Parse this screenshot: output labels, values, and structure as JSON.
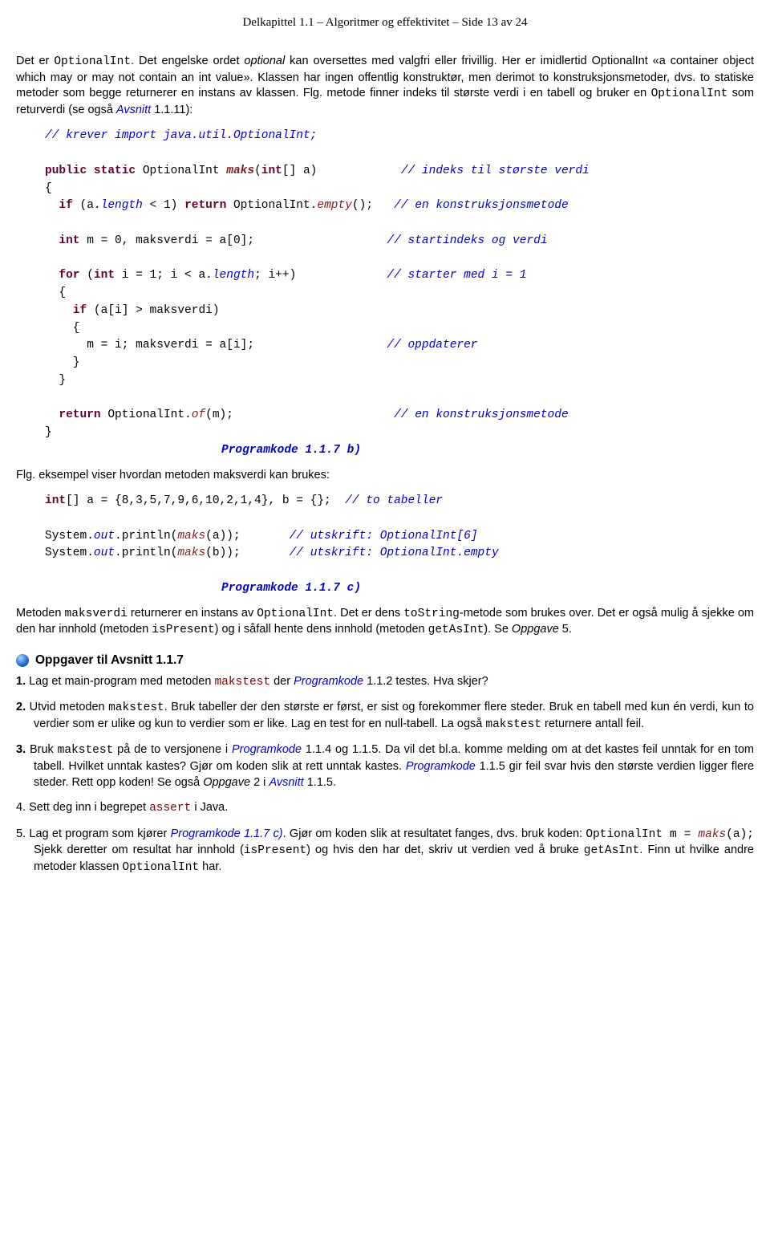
{
  "header": "Delkapittel 1.1 – Algoritmer og effektivitet – Side 13 av 24",
  "para1": {
    "t1": "Det er ",
    "optionalint": "OptionalInt",
    "t2": ". Det engelske ordet ",
    "optional": "optional",
    "t3": " kan oversettes med valgfri eller frivillig. Her er imidlertid OptionalInt «a container object which may or may not contain an int value». Klassen har ingen offentlig konstruktør, men derimot to konstruksjonsmetoder, dvs. to statiske metoder som begge returnerer en instans av klassen. Flg. metode finner indeks til største verdi i en tabell og bruker en ",
    "optionalint2": "OptionalInt",
    "t4": " som returverdi (se også ",
    "link1": "Avsnitt",
    "t5": " 1.1.11):"
  },
  "code1": {
    "l1c": "// krever import java.util.OptionalInt;",
    "l2a": "public static",
    "l2b": "OptionalInt",
    "l2c": "maks",
    "l2d": "(",
    "l2e": "int",
    "l2f": "[] a)",
    "l2cmt": "// indeks til største verdi",
    "l3": "{",
    "l4a": "  if",
    "l4b": " (a.",
    "l4c": "length",
    "l4d": " < 1) ",
    "l4e": "return",
    "l4f": " OptionalInt.",
    "l4g": "empty",
    "l4h": "();",
    "l4cmt": "// en konstruksjonsmetode",
    "l6a": "  int",
    "l6b": " m = 0, maksverdi = a[0];",
    "l6cmt": "// startindeks og verdi",
    "l8a": "  for",
    "l8b": " (",
    "l8c": "int",
    "l8d": " i = 1; i < a.",
    "l8e": "length",
    "l8f": "; i++)",
    "l8cmt": "// starter med i = 1",
    "l9": "  {",
    "l10a": "    if",
    "l10b": " (a[i] > maksverdi)",
    "l11": "    {",
    "l12a": "      m = i; maksverdi = a[i];",
    "l12cmt": "// oppdaterer",
    "l13": "    }",
    "l14": "  }",
    "l16a": "  return",
    "l16b": " OptionalInt.",
    "l16c": "of",
    "l16d": "(m);",
    "l16cmt": "// en konstruksjonsmetode",
    "l17": "}",
    "cap": "Programkode 1.1.7 b)"
  },
  "para2": "Flg. eksempel viser hvordan metoden maksverdi kan brukes:",
  "code2": {
    "l1a": "int",
    "l1b": "[] a = {8,3,5,7,9,6,10,2,1,4}, b = {};",
    "l1cmt": "// to tabeller",
    "l3a": "System.",
    "l3b": "out",
    "l3c": ".println(",
    "l3d": "maks",
    "l3e": "(a));",
    "l3cmt": "// utskrift: OptionalInt[6]",
    "l4a": "System.",
    "l4b": "out",
    "l4c": ".println(",
    "l4d": "maks",
    "l4e": "(b));",
    "l4cmt": "// utskrift: OptionalInt.empty",
    "cap": "Programkode 1.1.7 c)"
  },
  "para3": {
    "t1": "Metoden ",
    "m1": "maksverdi",
    "t2": " returnerer en instans av ",
    "m2": "OptionalInt",
    "t3": ". Det er dens ",
    "m3": "toString",
    "t4": "-metode som brukes over. Det er også mulig å sjekke om den har innhold (metoden ",
    "m4": "isPresent",
    "t5": ") og i såfall hente dens innhold (metoden ",
    "m5": "getAsInt",
    "t6": "). Se ",
    "m6": "Oppgave",
    "t7": " 5."
  },
  "section_title": "Oppgaver til Avsnitt 1.1.7",
  "ex1": {
    "n": "1.",
    "t1": " Lag et main-program med metoden ",
    "c1": "makstest",
    "t2": " der ",
    "c2": "Programkode",
    "t3": " 1.1.2 testes. Hva skjer?"
  },
  "ex2": {
    "n": "2.",
    "t1": " Utvid metoden ",
    "c1": "makstest",
    "t2": ". Bruk tabeller der den største er først, er sist og forekommer flere steder. Bruk en tabell med kun én verdi, kun to verdier som er ulike og kun to verdier som er like. Lag en test for en null-tabell. La også ",
    "c2": "makstest",
    "t3": " returnere antall feil."
  },
  "ex3": {
    "n": "3.",
    "t1": " Bruk ",
    "c1": "makstest",
    "t2": " på de to versjonene i ",
    "c2": "Programkode",
    "t3": " 1.1.4 og 1.1.5. Da vil det bl.a. komme melding om at det kastes feil unntak for en tom tabell. Hvilket unntak kastes? Gjør om koden slik at rett unntak kastes. ",
    "c3": "Programkode",
    "t4": " 1.1.5 gir feil svar hvis den største verdien ligger flere steder. Rett opp koden! Se også ",
    "c4": "Oppgave",
    "t5": " 2 i ",
    "c5": "Avsnitt",
    "t6": " 1.1.5."
  },
  "ex4": {
    "n": "4.",
    "t1": " Sett deg inn i begrepet ",
    "c1": "assert",
    "t2": " i Java."
  },
  "ex5": {
    "n": "5.",
    "t1": " Lag et program som kjører ",
    "c1": "Programkode",
    "t2": " ",
    "c2": "1.1.7 c)",
    "t3": ". Gjør om koden slik at resultatet fanges, dvs. bruk koden: ",
    "c3": "OptionalInt m = ",
    "c4": "maks",
    "c5": "(a);",
    "t4": " Sjekk deretter om resultat har innhold (",
    "c6": "isPresent",
    "t5": ") og hvis den har det, skriv ut verdien ved å bruke ",
    "c7": "getAsInt",
    "t6": ". Finn ut hvilke andre metoder klassen ",
    "c8": "OptionalInt",
    "t7": " har."
  }
}
